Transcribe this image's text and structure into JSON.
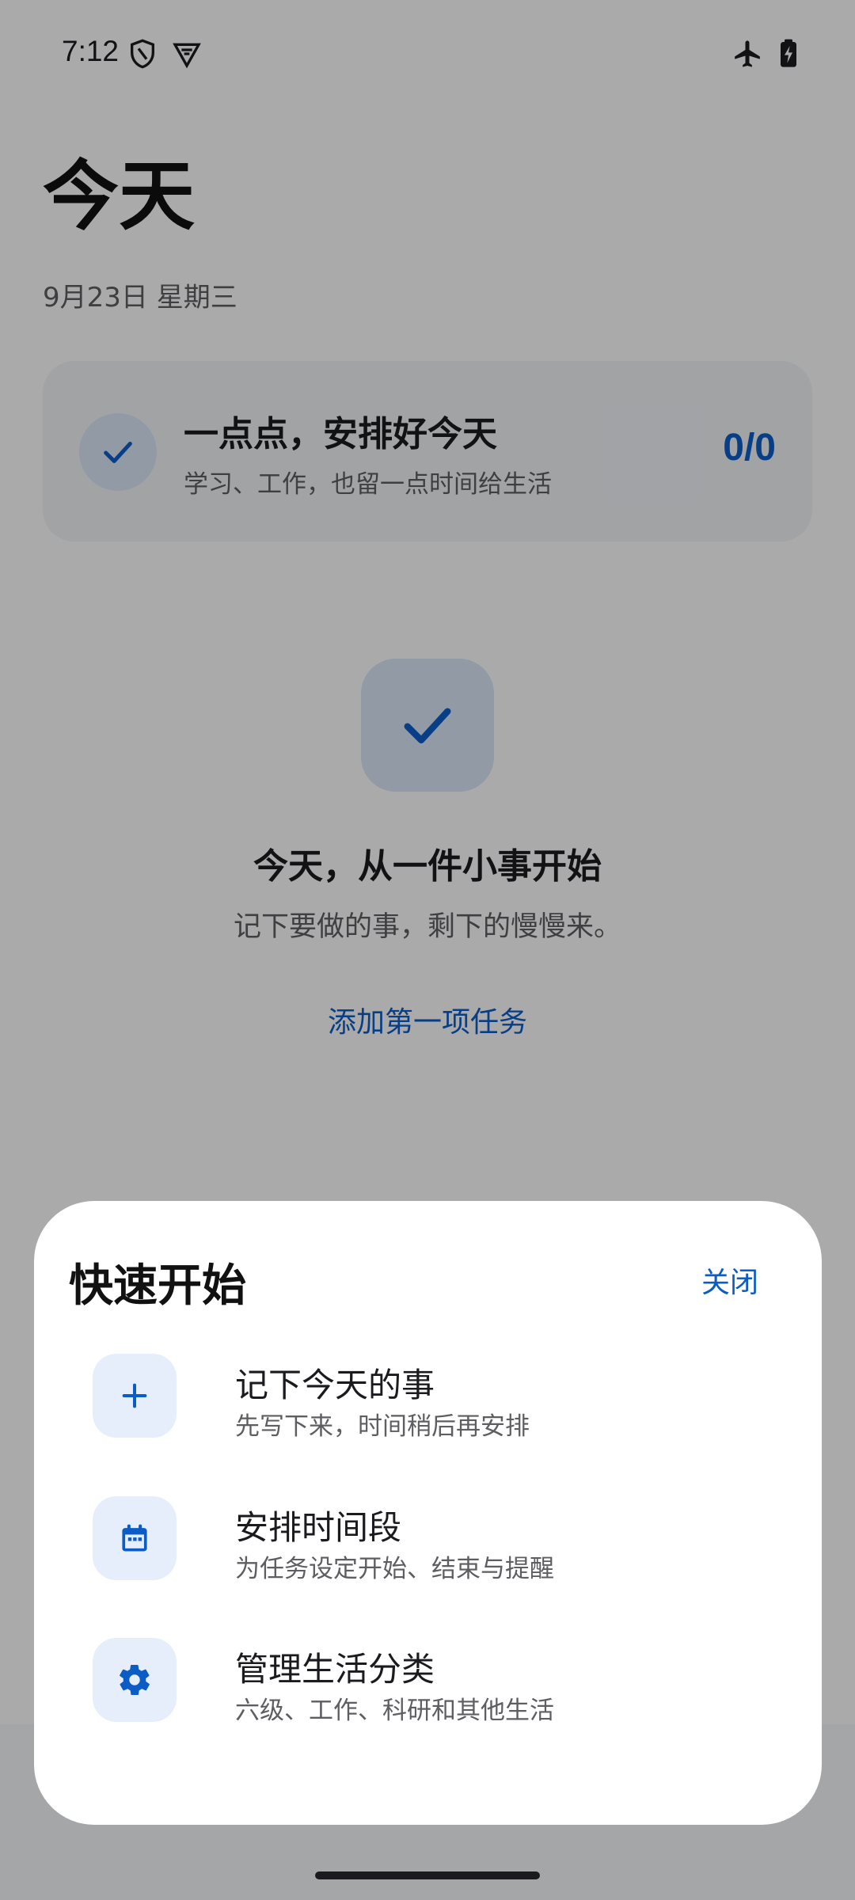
{
  "status_bar": {
    "time": "7:12",
    "left_icons": [
      "shield-icon",
      "vpn-badge-icon"
    ],
    "right_icons": [
      "airplane-mode-icon",
      "battery-charging-icon"
    ]
  },
  "header": {
    "title": "今天",
    "date": "9月23日 星期三"
  },
  "summary_card": {
    "title": "一点点，安排好今天",
    "subtitle": "学习、工作，也留一点时间给生活",
    "count": "0/0"
  },
  "empty_state": {
    "title": "今天，从一件小事开始",
    "subtitle": "记下要做的事，剩下的慢慢来。",
    "action_label": "添加第一项任务"
  },
  "quick_start_sheet": {
    "title": "快速开始",
    "close_label": "关闭",
    "items": [
      {
        "title": "记下今天的事",
        "subtitle": "先写下来，时间稍后再安排",
        "icon": "plus-icon"
      },
      {
        "title": "安排时间段",
        "subtitle": "为任务设定开始、结束与提醒",
        "icon": "calendar-icon"
      },
      {
        "title": "管理生活分类",
        "subtitle": "六级、工作、科研和其他生活",
        "icon": "gear-icon"
      }
    ]
  },
  "colors": {
    "accent": "#0b5cc4",
    "scrim": "rgba(0,0,0,0.32)",
    "icon_tile": "#e6eefb"
  }
}
